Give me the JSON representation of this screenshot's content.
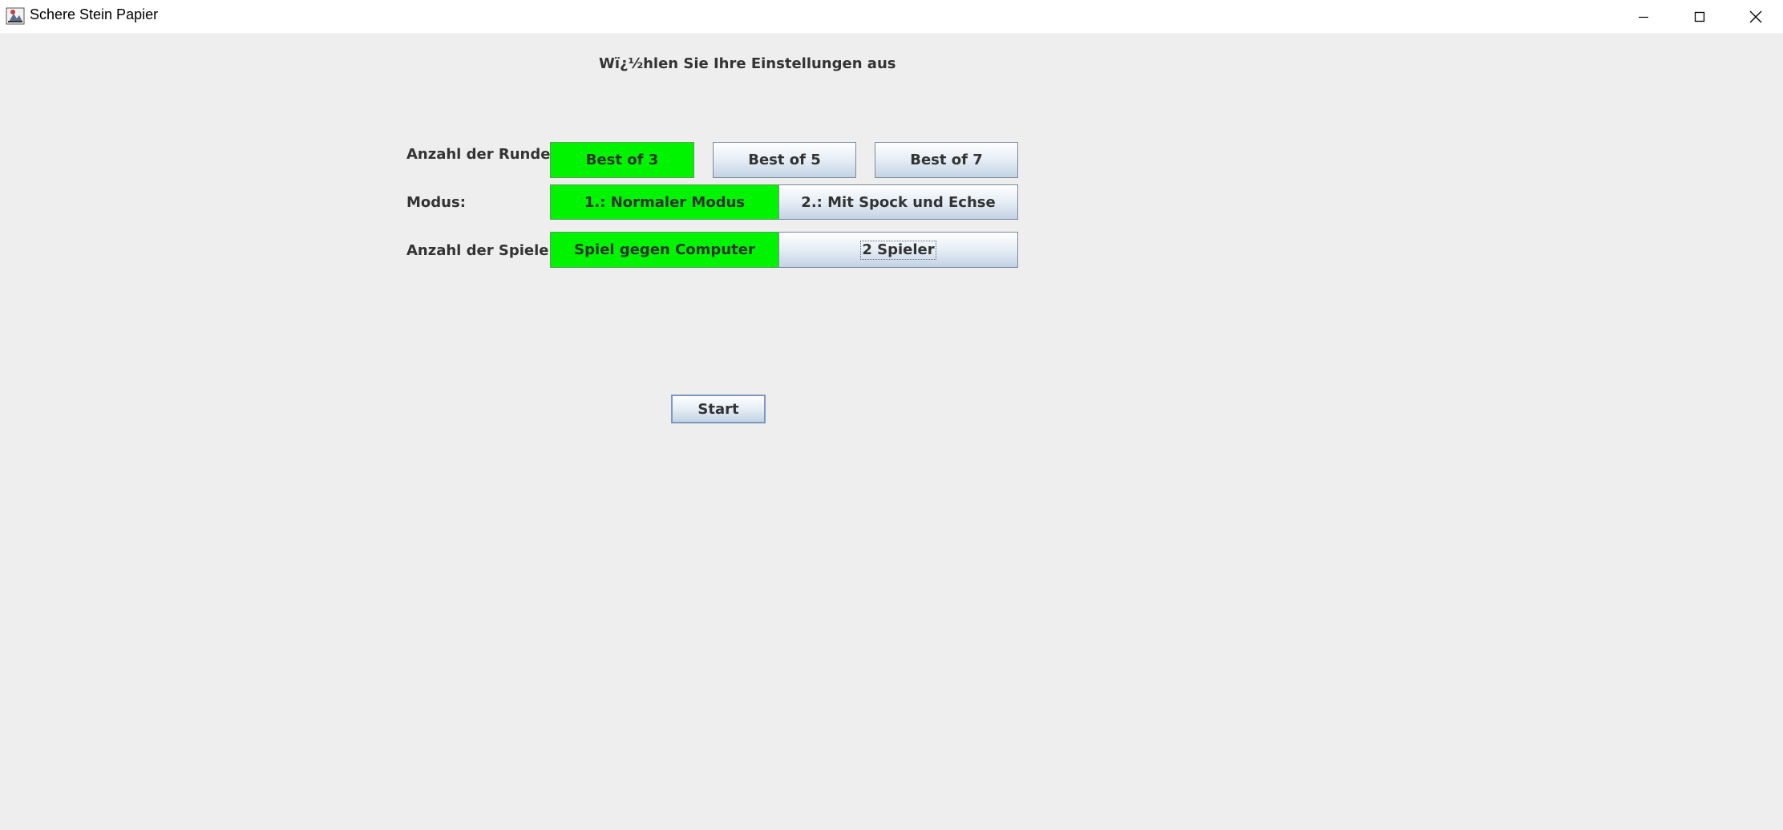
{
  "window": {
    "title": "Schere Stein Papier"
  },
  "heading": "Wï¿½hlen Sie Ihre Einstellungen aus",
  "rounds": {
    "label": "Anzahl der Runden:",
    "options": [
      "Best of 3",
      "Best of 5",
      "Best of 7"
    ],
    "selected": "Best of 3"
  },
  "mode": {
    "label": "Modus:",
    "options": [
      "1.: Normaler Modus",
      "2.: Mit Spock und Echse"
    ],
    "selected": "1.: Normaler Modus"
  },
  "players": {
    "label": "Anzahl der Spieler:",
    "options": [
      "Spiel gegen Computer",
      "2 Spieler"
    ],
    "selected": "Spiel gegen Computer",
    "focused": "2 Spieler"
  },
  "start_label": "Start",
  "colors": {
    "selected": "#00f400",
    "background": "#eeeeee"
  },
  "icons": {
    "app": "java-app-icon",
    "minimize": "minimize-icon",
    "maximize": "maximize-icon",
    "close": "close-icon"
  }
}
